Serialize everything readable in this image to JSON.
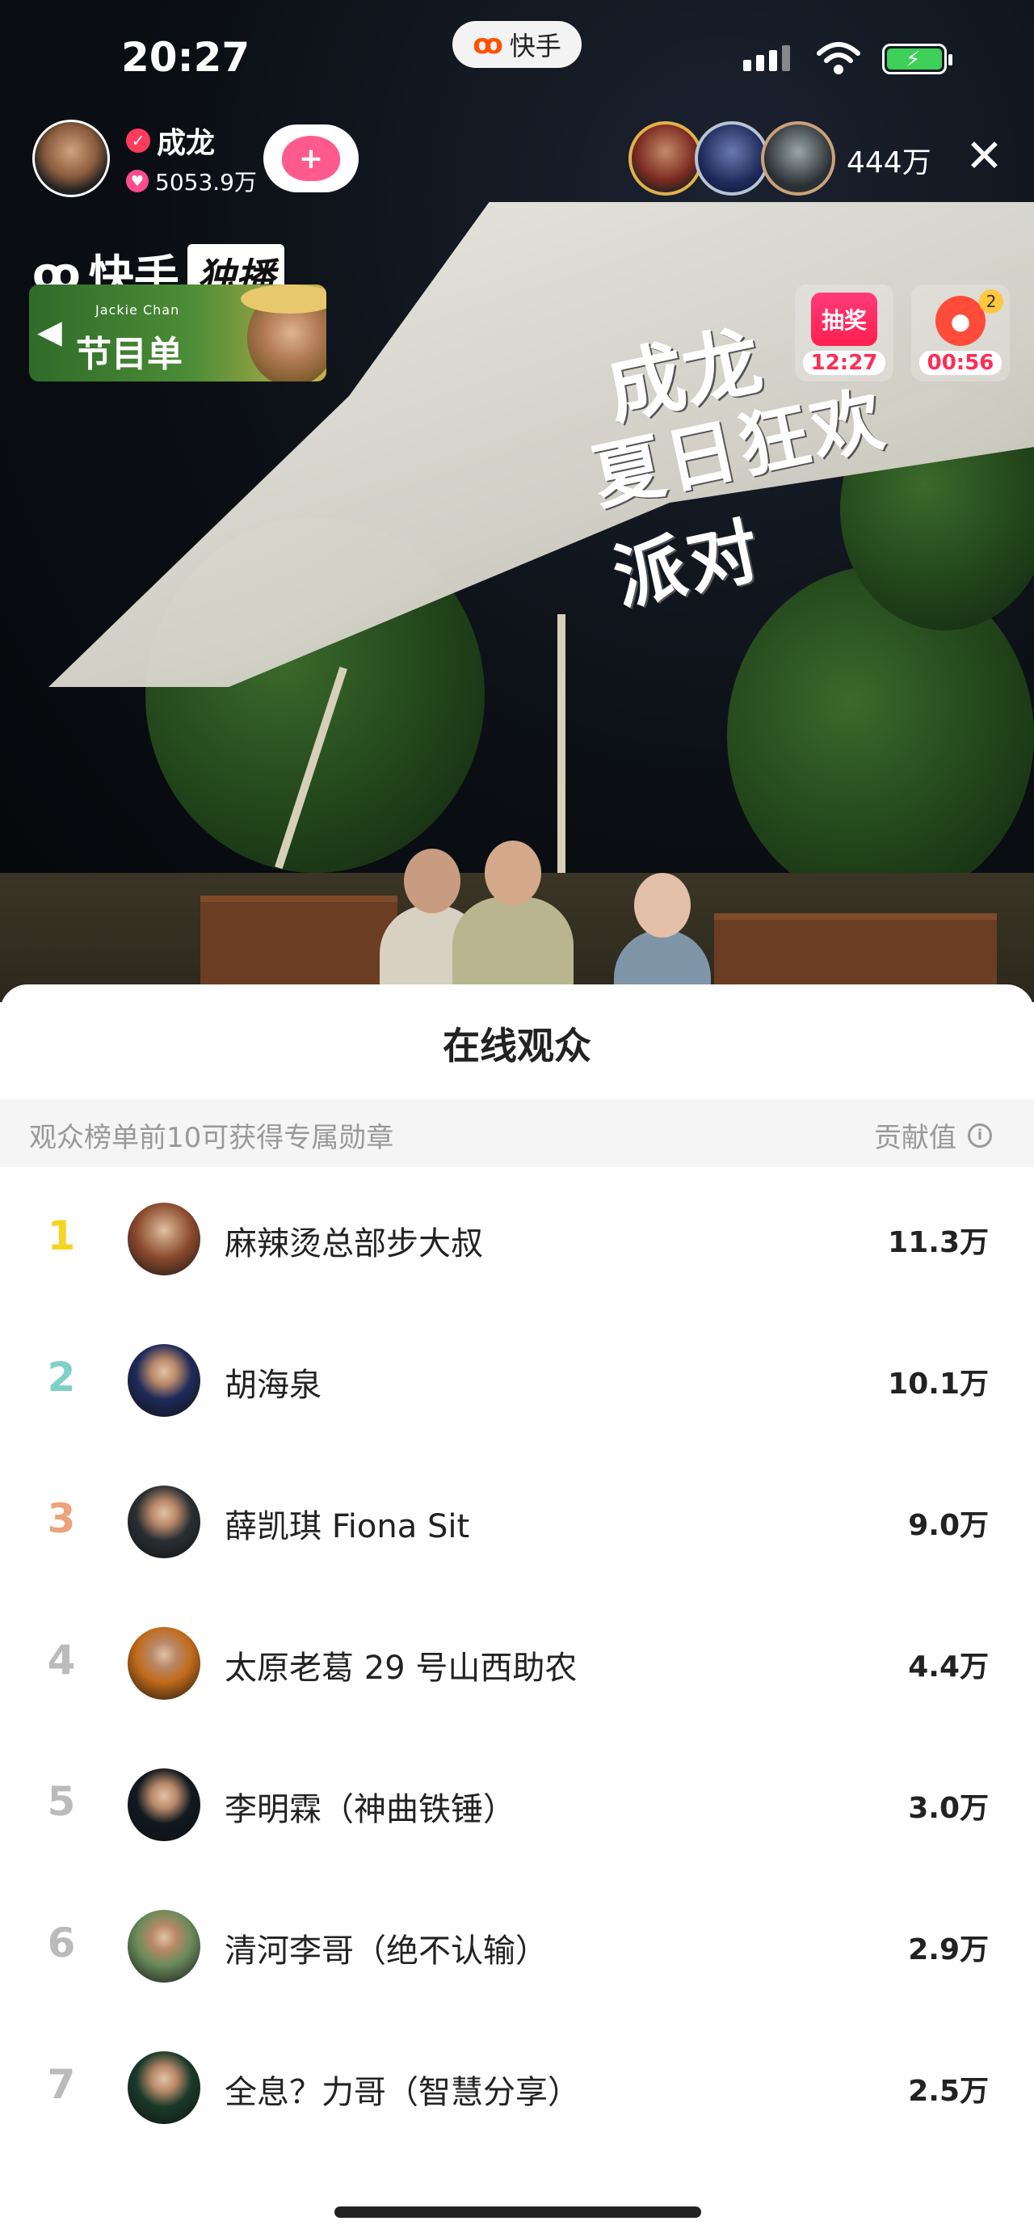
{
  "status_bar": {
    "time": "20:27",
    "app_pill_label": "快手",
    "battery_color": "#3fd05a"
  },
  "live_header": {
    "host_name": "成龙",
    "host_likes": "5053.9万",
    "viewer_count": "444万",
    "close_icon": "close-icon",
    "follow_icon": "heart-plus-icon"
  },
  "overlay": {
    "brand_name": "快手",
    "brand_badge": "独播",
    "program_card_subtitle": "Jackie Chan",
    "program_card_title": "节目单",
    "lottery_label": "抽奖",
    "lottery_timer": "12:27",
    "redpacket_timer": "00:56",
    "redpacket_count": "2",
    "stage_banner_line1": "成龙",
    "stage_banner_line2": "夏日狂欢派对"
  },
  "sheet": {
    "title": "在线观众",
    "notice": "观众榜单前10可获得专属勋章",
    "value_label": "贡献值",
    "rank_colors": {
      "1": "#f5d524",
      "2": "#7fd0c6",
      "3": "#eea27a"
    },
    "rows": [
      {
        "rank": "1",
        "name": "麻辣烫总部步大叔",
        "score": "11.3万",
        "avatar_color": "#8b4a2e"
      },
      {
        "rank": "2",
        "name": "胡海泉",
        "score": "10.1万",
        "avatar_color": "#1e2a5a"
      },
      {
        "rank": "3",
        "name": "薛凯琪 Fiona Sit",
        "score": "9.0万",
        "avatar_color": "#2a2f33"
      },
      {
        "rank": "4",
        "name": "太原老葛 29 号山西助农",
        "score": "4.4万",
        "avatar_color": "#c26a1a"
      },
      {
        "rank": "5",
        "name": "李明霖（神曲铁锤）",
        "score": "3.0万",
        "avatar_color": "#101820"
      },
      {
        "rank": "6",
        "name": "清河李哥（绝不认输）",
        "score": "2.9万",
        "avatar_color": "#6a8a5a"
      },
      {
        "rank": "7",
        "name": "全息？力哥（智慧分享）",
        "score": "2.5万",
        "avatar_color": "#1a3a2a"
      }
    ]
  }
}
